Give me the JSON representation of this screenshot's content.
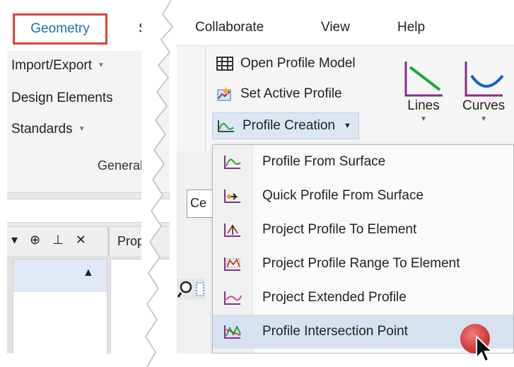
{
  "left_panel": {
    "tabs": {
      "geometry": "Geometry",
      "site": "Sit"
    },
    "ribbon": {
      "items": [
        {
          "label": "Import/Export",
          "dropdown": true
        },
        {
          "label": "Design Elements",
          "dropdown": false
        },
        {
          "label": "Standards",
          "dropdown": true
        }
      ],
      "group_label": "General"
    },
    "panel_tab": "Prop",
    "panel_controls": "▾ ⊕ ⊥ ✕"
  },
  "right_panel": {
    "menu_tabs": [
      "Collaborate",
      "View",
      "Help"
    ],
    "ribbon": {
      "open_profile_model": "Open Profile Model",
      "set_active_profile": "Set Active Profile",
      "profile_creation": "Profile Creation",
      "lines": "Lines",
      "curves": "Curves"
    },
    "cen_tab": "Ce",
    "dropdown": {
      "items": [
        {
          "label": "Profile From Surface",
          "icon": "profile-from-surface-icon"
        },
        {
          "label": "Quick Profile From Surface",
          "icon": "quick-profile-icon"
        },
        {
          "label": "Project Profile To Element",
          "icon": "project-profile-icon"
        },
        {
          "label": "Project Profile Range To Element",
          "icon": "project-profile-range-icon"
        },
        {
          "label": "Project Extended Profile",
          "icon": "project-extended-profile-icon"
        },
        {
          "label": "Profile Intersection Point",
          "icon": "profile-intersection-point-icon"
        }
      ],
      "highlighted_index": 5
    }
  },
  "colors": {
    "accent_blue": "#1f6fb8",
    "highlight_border": "#e0403e",
    "hover_bg": "#d6e2f0",
    "lines_icon": "#1aaa3a",
    "curves_icon": "#1560d0",
    "icon_frame": "#8a2a8a"
  }
}
